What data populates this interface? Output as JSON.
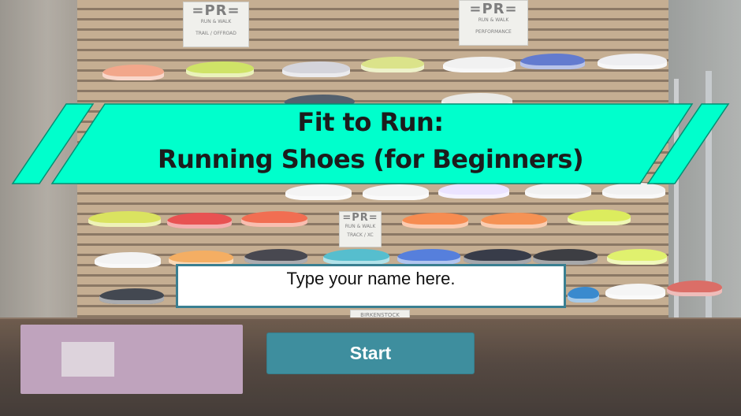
{
  "background": {
    "description_icon": "shoe-store-wall-photo",
    "signs": [
      {
        "brand": "=PR=",
        "sub": "RUN & WALK",
        "category": "TRAIL / OFFROAD"
      },
      {
        "brand": "=PR=",
        "sub": "RUN & WALK",
        "category": "PERFORMANCE"
      },
      {
        "brand": "=PR=",
        "sub": "RUN & WALK",
        "category": "TRACK / XC"
      },
      {
        "brand": "BIRKENSTOCK",
        "sub": "",
        "category": ""
      }
    ]
  },
  "title": {
    "line1": "Fit to Run:",
    "line2": "Running Shoes (for Beginners)"
  },
  "name_input": {
    "placeholder": "Type your name here.",
    "value": ""
  },
  "start_button": {
    "label": "Start"
  },
  "colors": {
    "banner": "#00ffcc",
    "banner_stroke": "#008f73",
    "button": "#3e8e9e",
    "input_border": "#3a7f91"
  }
}
